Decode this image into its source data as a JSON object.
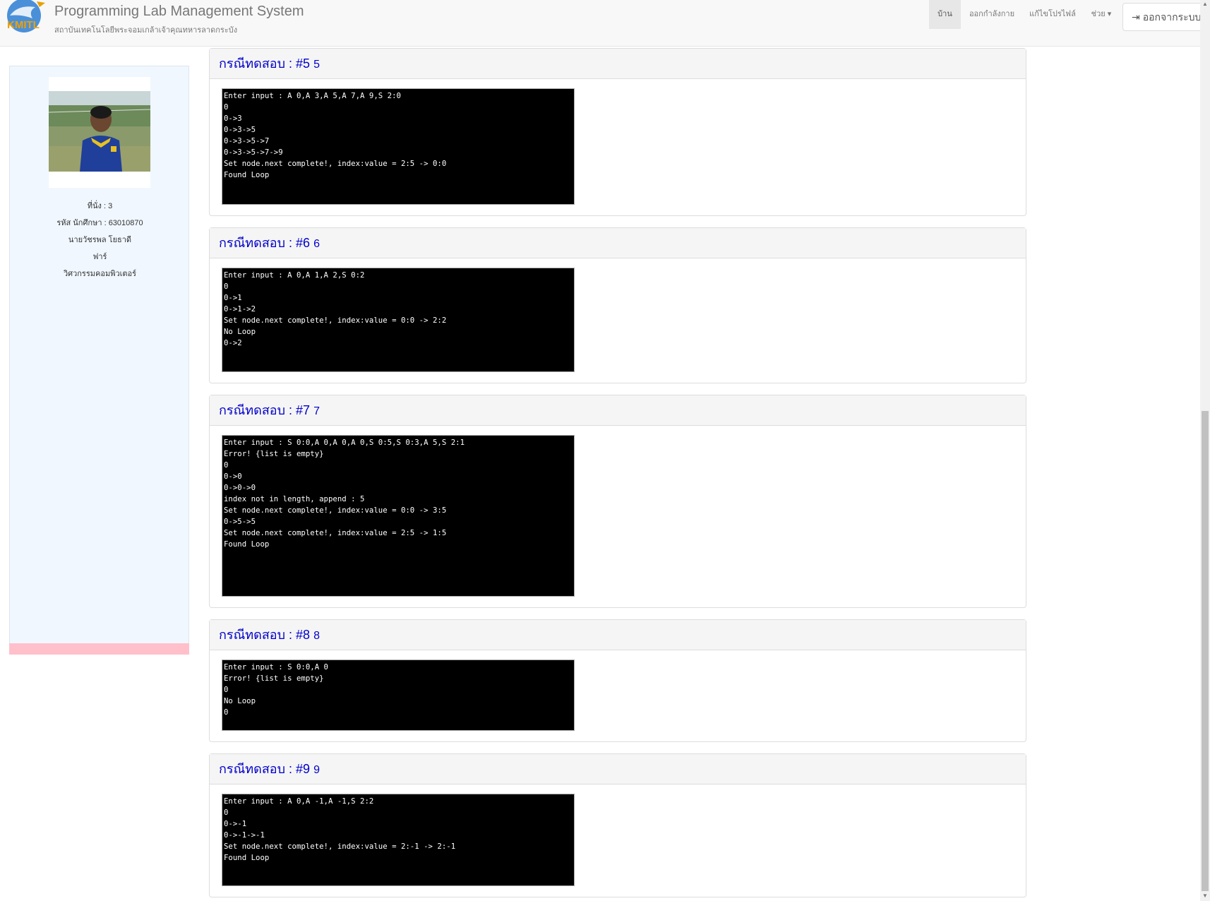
{
  "navbar": {
    "title": "Programming Lab Management System",
    "subtitle": "สถาบันเทคโนโลยีพระจอมเกล้าเจ้าคุณทหารลาดกระบัง",
    "logo_text": "KMITL",
    "items": [
      {
        "label": "บ้าน",
        "active": true
      },
      {
        "label": "ออกกำลังกาย",
        "active": false
      },
      {
        "label": "แก้ไขโปรไฟล์",
        "active": false
      },
      {
        "label": "ช่วย ▾",
        "active": false
      }
    ],
    "logout_label": "ออกจากระบบ"
  },
  "sidebar": {
    "lines": [
      "ที่นั่ง : 3",
      "รหัส นักศึกษา : 63010870",
      "นายวัชรพล โยธาดี",
      "ฟาร์",
      "วิศวกรรมคอมพิวเตอร์"
    ]
  },
  "testcases": [
    {
      "heading": "กรณีทดสอบ : #5",
      "num": "5",
      "output": "Enter input : A 0,A 3,A 5,A 7,A 9,S 2:0\n0\n0->3\n0->3->5\n0->3->5->7\n0->3->5->7->9\nSet node.next complete!, index:value = 2:5 -> 0:0\nFound Loop"
    },
    {
      "heading": "กรณีทดสอบ : #6",
      "num": "6",
      "output": "Enter input : A 0,A 1,A 2,S 0:2\n0\n0->1\n0->1->2\nSet node.next complete!, index:value = 0:0 -> 2:2\nNo Loop\n0->2"
    },
    {
      "heading": "กรณีทดสอบ : #7",
      "num": "7",
      "output": "Enter input : S 0:0,A 0,A 0,A 0,S 0:5,S 0:3,A 5,S 2:1\nError! {list is empty}\n0\n0->0\n0->0->0\nindex not in length, append : 5\nSet node.next complete!, index:value = 0:0 -> 3:5\n0->5->5\nSet node.next complete!, index:value = 2:5 -> 1:5\nFound Loop"
    },
    {
      "heading": "กรณีทดสอบ : #8",
      "num": "8",
      "output": "Enter input : S 0:0,A 0\nError! {list is empty}\n0\nNo Loop\n0"
    },
    {
      "heading": "กรณีทดสอบ : #9",
      "num": "9",
      "output": "Enter input : A 0,A -1,A -1,S 2:2\n0\n0->-1\n0->-1->-1\nSet node.next complete!, index:value = 2:-1 -> 2:-1\nFound Loop"
    }
  ]
}
